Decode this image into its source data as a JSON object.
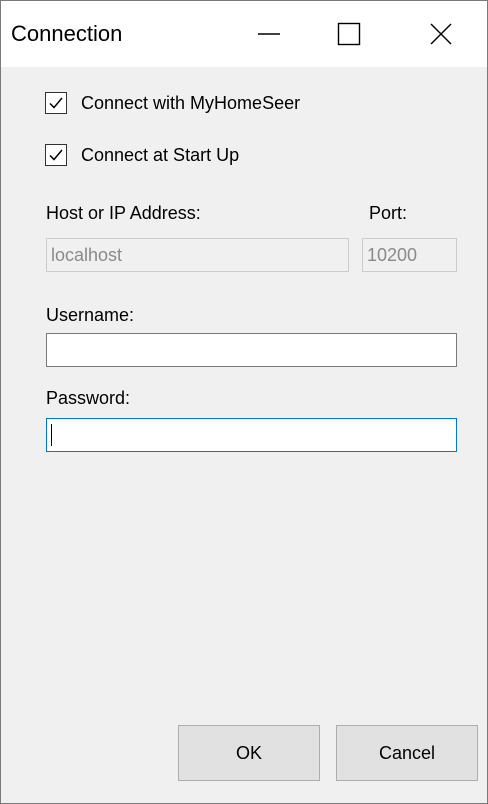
{
  "window": {
    "title": "Connection",
    "controls": {
      "minimize_icon": "minimize-icon",
      "maximize_icon": "maximize-icon",
      "close_icon": "close-icon"
    }
  },
  "options": {
    "connect_myhomeseer": {
      "label": "Connect with MyHomeSeer",
      "checked": true
    },
    "connect_startup": {
      "label": "Connect at Start Up",
      "checked": true
    }
  },
  "host": {
    "label": "Host or IP Address:",
    "value": "localhost",
    "enabled": false
  },
  "port": {
    "label": "Port:",
    "value": "10200",
    "enabled": false
  },
  "username": {
    "label": "Username:",
    "value": ""
  },
  "password": {
    "label": "Password:",
    "value": "",
    "focused": true
  },
  "buttons": {
    "ok": "OK",
    "cancel": "Cancel"
  },
  "colors": {
    "focus_accent": "#0078d7",
    "dialog_background": "#f0f0f0",
    "button_face": "#e1e1e1"
  }
}
